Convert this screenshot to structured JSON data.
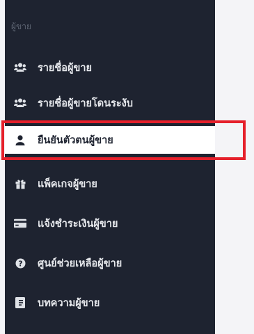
{
  "sidebar": {
    "section_header": "ผู้ขาย",
    "items": [
      {
        "label": "รายชื่อผู้ขาย",
        "icon": "users-icon",
        "active": false
      },
      {
        "label": "รายชื่อผู้ขายโดนระงับ",
        "icon": "users-icon",
        "active": false
      },
      {
        "label": "ยืนยันตัวตนผู้ขาย",
        "icon": "user-icon",
        "active": true
      },
      {
        "label": "แพ็คเกจผู้ขาย",
        "icon": "gift-icon",
        "active": false
      },
      {
        "label": "แจ้งชำระเงินผู้ขาย",
        "icon": "credit-card-icon",
        "active": false
      },
      {
        "label": "ศูนย์ช่วยเหลือผู้ขาย",
        "icon": "question-circle-icon",
        "active": false
      },
      {
        "label": "บทความผู้ขาย",
        "icon": "article-icon",
        "active": false
      }
    ]
  },
  "colors": {
    "sidebar_bg": "#1e2330",
    "highlight_border": "#e5202b",
    "active_bg": "#ffffff"
  }
}
